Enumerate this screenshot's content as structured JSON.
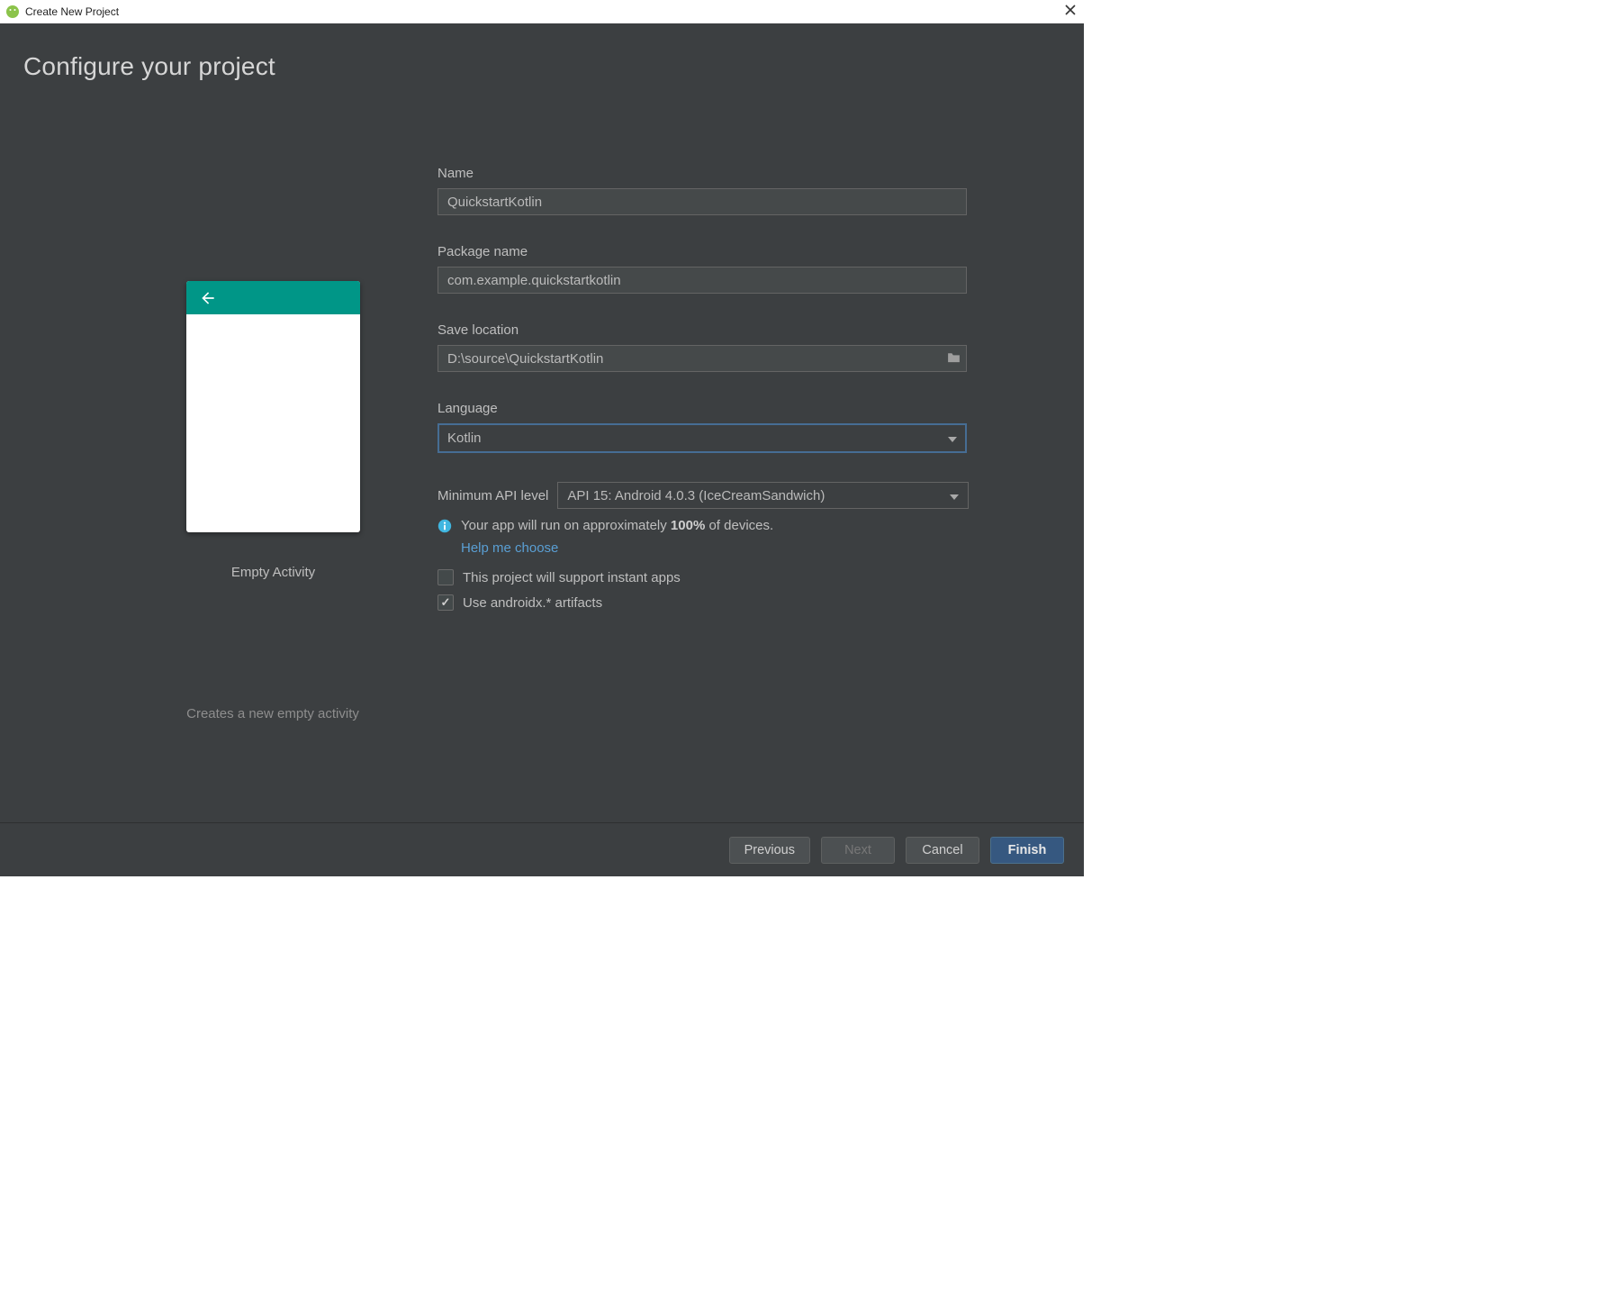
{
  "window": {
    "title": "Create New Project"
  },
  "page": {
    "heading": "Configure your project"
  },
  "preview": {
    "template_name": "Empty Activity",
    "description": "Creates a new empty activity"
  },
  "form": {
    "name_label": "Name",
    "name_value": "QuickstartKotlin",
    "package_label": "Package name",
    "package_value": "com.example.quickstartkotlin",
    "location_label": "Save location",
    "location_value": "D:\\source\\QuickstartKotlin",
    "language_label": "Language",
    "language_value": "Kotlin",
    "api_label": "Minimum API level",
    "api_value": "API 15: Android 4.0.3 (IceCreamSandwich)",
    "info_prefix": "Your app will run on approximately ",
    "info_percent": "100%",
    "info_suffix": " of devices.",
    "help_link": "Help me choose",
    "instant_apps_label": "This project will support instant apps",
    "instant_apps_checked": false,
    "androidx_label": "Use androidx.* artifacts",
    "androidx_checked": true
  },
  "footer": {
    "previous": "Previous",
    "next": "Next",
    "cancel": "Cancel",
    "finish": "Finish"
  }
}
